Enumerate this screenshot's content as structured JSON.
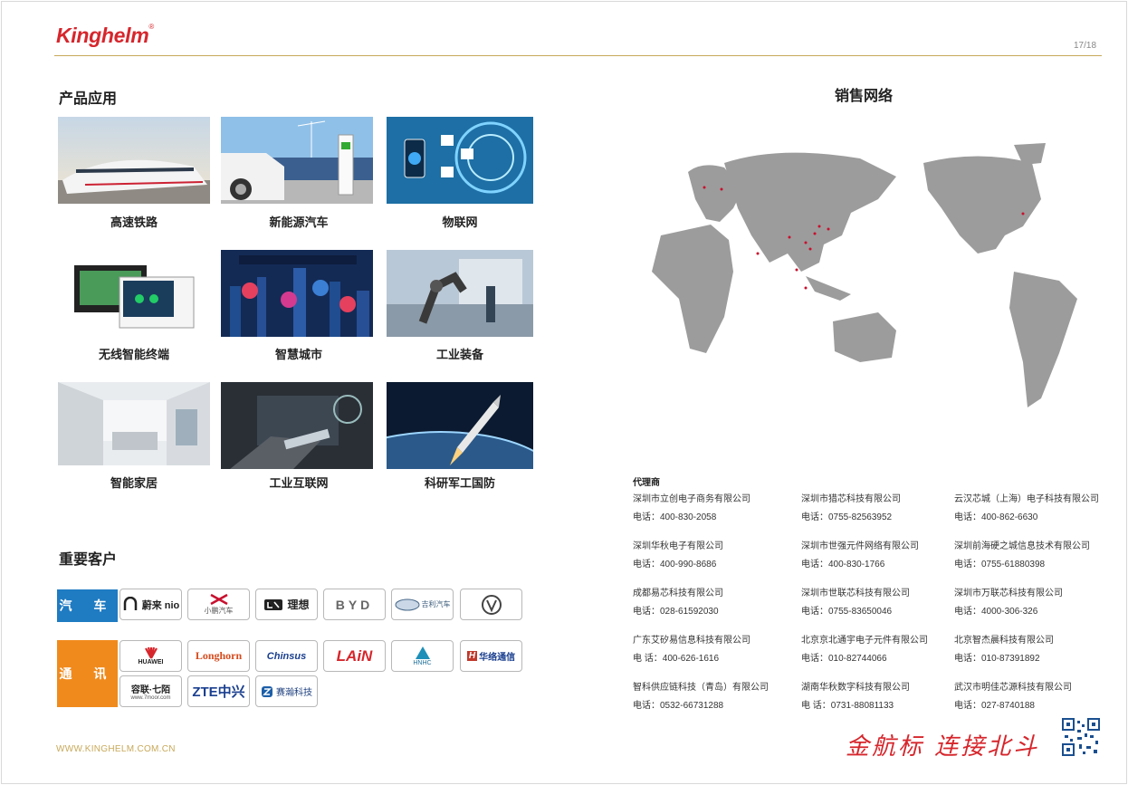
{
  "header": {
    "logo_text": "Kinghelm",
    "logo_mark": "®",
    "page_number": "17/18"
  },
  "colors": {
    "brand_red": "#d6262c",
    "gold_rule": "#c8a95a",
    "auto_blue": "#1f7bc2",
    "telecom_orange": "#f08a1c"
  },
  "applications": {
    "title": "产品应用",
    "items": [
      {
        "label": "高速铁路",
        "icon": "high-speed-train-photo"
      },
      {
        "label": "新能源汽车",
        "icon": "ev-charging-photo"
      },
      {
        "label": "物联网",
        "icon": "iot-photo"
      },
      {
        "label": "无线智能终端",
        "icon": "smart-terminal-photo"
      },
      {
        "label": "智慧城市",
        "icon": "smart-city-photo"
      },
      {
        "label": "工业装备",
        "icon": "industrial-robot-photo"
      },
      {
        "label": "智能家居",
        "icon": "smart-home-photo"
      },
      {
        "label": "工业互联网",
        "icon": "industrial-internet-photo"
      },
      {
        "label": "科研军工国防",
        "icon": "rocket-photo"
      }
    ]
  },
  "sales": {
    "title": "销售网络"
  },
  "customers": {
    "title": "重要客户",
    "auto_label": "汽 车",
    "telecom_label": "通 讯",
    "auto_brands": [
      "蔚来 nio",
      "小鹏汽车",
      "理想",
      "BYD",
      "吉利汽车",
      "长安"
    ],
    "telecom_brands": [
      "HUAWEI",
      "Longhorn",
      "Chinsus",
      "LAiN",
      "HNHC",
      "华络通信",
      "容联·七陌",
      "ZTE中兴",
      "赛瀚科技"
    ],
    "telecom_subtexts": {
      "rongian": "www.7moor.com",
      "hnhc": "HNHC",
      "hualuo": "HUALUO COMMUNICATIONS"
    }
  },
  "distributors": {
    "title": "代理商",
    "list": [
      {
        "name": "深圳市立创电子商务有限公司",
        "phone": "电话：400-830-2058"
      },
      {
        "name": "深圳市猎芯科技有限公司",
        "phone": "电话：0755-82563952"
      },
      {
        "name": "云汉芯城（上海）电子科技有限公司",
        "phone": "电话：400-862-6630"
      },
      {
        "name": "深圳华秋电子有限公司",
        "phone": "电话：400-990-8686"
      },
      {
        "name": "深圳市世强元件网络有限公司",
        "phone": "电话：400-830-1766"
      },
      {
        "name": "深圳前海硬之城信息技术有限公司",
        "phone": "电话：0755-61880398"
      },
      {
        "name": "成都易芯科技有限公司",
        "phone": "电话：028-61592030"
      },
      {
        "name": "深圳市世联芯科技有限公司",
        "phone": "电话：0755-83650046"
      },
      {
        "name": "深圳市万联芯科技有限公司",
        "phone": "电话：4000-306-326"
      },
      {
        "name": "广东艾矽易信息科技有限公司",
        "phone": "电 话：400-626-1616"
      },
      {
        "name": "北京京北通宇电子元件有限公司",
        "phone": "电话：010-82744066"
      },
      {
        "name": "北京智杰晨科技有限公司",
        "phone": "电话：010-87391892"
      },
      {
        "name": "智科供应链科技（青岛）有限公司",
        "phone": "电话：0532-66731288"
      },
      {
        "name": "湖南华秋数字科技有限公司",
        "phone": "电 话：0731-88081133"
      },
      {
        "name": "武汉市明佳芯源科技有限公司",
        "phone": "电话：027-8740188"
      }
    ]
  },
  "footer": {
    "url": "WWW.KINGHELM.COM.CN",
    "slogan": "金航标 连接北斗",
    "qr_icon": "qr-code-icon"
  }
}
